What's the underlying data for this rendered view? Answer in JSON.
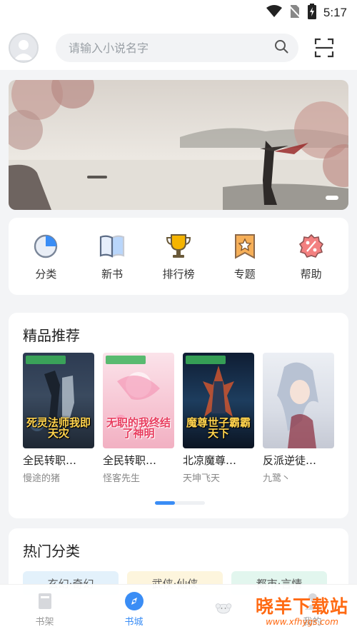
{
  "status_bar": {
    "time": "5:17"
  },
  "search": {
    "placeholder": "请输入小说名字"
  },
  "quick_nav": [
    {
      "label": "分类",
      "icon": "pie-chart-icon",
      "color": "#3a8df5"
    },
    {
      "label": "新书",
      "icon": "open-book-icon",
      "color": "#3a8df5"
    },
    {
      "label": "排行榜",
      "icon": "trophy-icon",
      "color": "#f5b400"
    },
    {
      "label": "专题",
      "icon": "ribbon-star-icon",
      "color": "#f5a23c"
    },
    {
      "label": "帮助",
      "icon": "percent-badge-icon",
      "color": "#f26a6a"
    }
  ],
  "recommend": {
    "title": "精品推荐",
    "books": [
      {
        "title": "全民转职…",
        "author": "慢途的猪",
        "cover_text": "死灵法师我即天灾"
      },
      {
        "title": "全民转职…",
        "author": "怪客先生",
        "cover_text": "无职的我终结了神明"
      },
      {
        "title": "北凉魔尊…",
        "author": "天坤飞天",
        "cover_text": "魔尊世子霸霸天下"
      },
      {
        "title": "反派逆徒…",
        "author": "九鹭丶",
        "cover_text": ""
      }
    ]
  },
  "categories": {
    "title": "热门分类",
    "chips": [
      {
        "label": "玄幻·奇幻",
        "bg": "#e3f1fb",
        "fg": "#555"
      },
      {
        "label": "武侠·仙侠",
        "bg": "#fdf5dd",
        "fg": "#555"
      },
      {
        "label": "都市·言情",
        "bg": "#e2f6ee",
        "fg": "#555"
      }
    ]
  },
  "tabbar": [
    {
      "label": "书架",
      "icon": "bookshelf-icon",
      "active": false
    },
    {
      "label": "书城",
      "icon": "compass-icon",
      "active": true
    },
    {
      "label": "",
      "icon": "sheep-icon",
      "active": false
    },
    {
      "label": "我的",
      "icon": "user-icon",
      "active": false
    }
  ],
  "watermark": {
    "main": "晓羊下载站",
    "sub": "www.xfhygs.com"
  },
  "colors": {
    "accent": "#3a8df5",
    "watermark": "#ff6a13"
  }
}
